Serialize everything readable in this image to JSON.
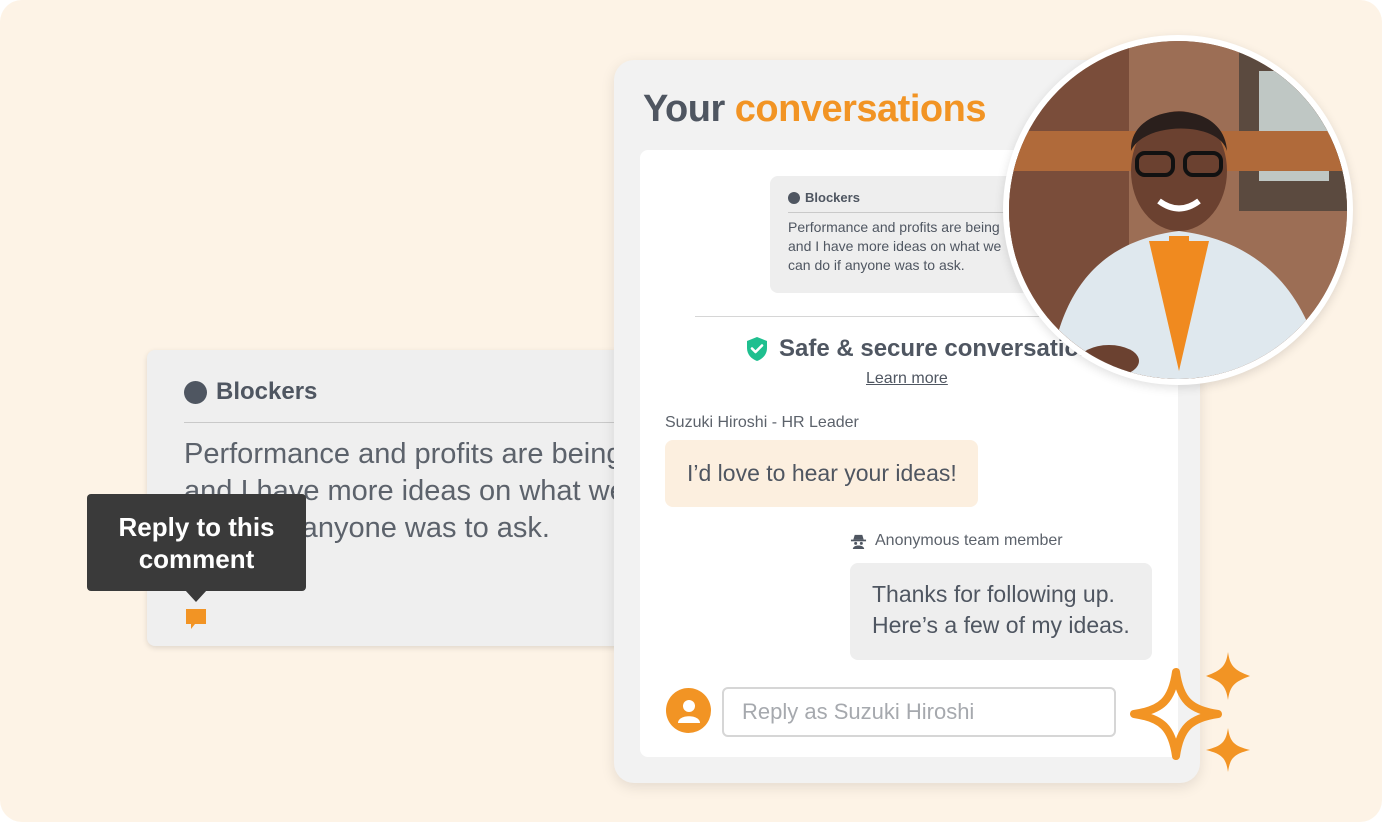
{
  "comment_card": {
    "category": "Blockers",
    "body_lines": [
      "Performance and profits are being",
      "and I have more ideas on what we",
      "can do if anyone was to ask."
    ]
  },
  "tooltip": {
    "line1": "Reply to this",
    "line2": "comment"
  },
  "panel": {
    "title_part1": "Your ",
    "title_part2": "conversations",
    "mini_card": {
      "category": "Blockers",
      "body_lines": [
        "Performance and profits are being",
        "and I have more ideas on what we",
        "can do if anyone was to ask."
      ]
    },
    "secure_label": "Safe & secure conversations",
    "learn_more": "Learn more",
    "messages": [
      {
        "sender": "Suzuki Hiroshi - HR Leader",
        "text": "I’d love to hear your ideas!"
      },
      {
        "sender": "Anonymous team member",
        "lines": [
          "Thanks for following up.",
          "Here’s a few of my ideas."
        ]
      }
    ],
    "reply_placeholder": "Reply as Suzuki Hiroshi"
  },
  "colors": {
    "background": "#fdf3e6",
    "accent_orange": "#f29424",
    "text_dark": "#4f5661",
    "shield_green": "#1fbf8f"
  },
  "icons": [
    "chat-bubble-icon",
    "shield-check-icon",
    "incognito-icon",
    "user-icon",
    "sparkle-icon"
  ]
}
